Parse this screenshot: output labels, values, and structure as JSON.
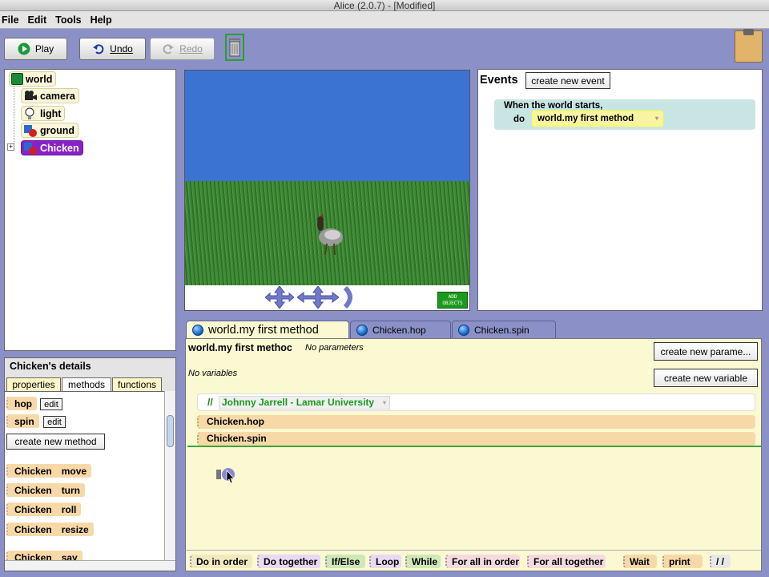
{
  "window": {
    "title": "Alice (2.0.7) -  [Modified]"
  },
  "menu": [
    "File",
    "Edit",
    "Tools",
    "Help"
  ],
  "toolbar": {
    "play": "Play",
    "undo": "Undo",
    "redo": "Redo"
  },
  "tree": {
    "world": "world",
    "camera": "camera",
    "light": "light",
    "ground": "ground",
    "chicken": "Chicken"
  },
  "view": {
    "add_objects": "ADD OBJECTS"
  },
  "events": {
    "title": "Events",
    "create_button": "create new event",
    "block_line1": "When the world starts,",
    "block_do": "do",
    "block_method": "world.my first method"
  },
  "details": {
    "title": "Chicken's details",
    "tabs": [
      "properties",
      "methods",
      "functions"
    ],
    "custom_methods": [
      {
        "name": "hop",
        "edit": "edit"
      },
      {
        "name": "spin",
        "edit": "edit"
      }
    ],
    "create_method": "create new method",
    "builtin_methods": [
      {
        "obj": "Chicken",
        "method": "move"
      },
      {
        "obj": "Chicken",
        "method": "turn"
      },
      {
        "obj": "Chicken",
        "method": "roll"
      },
      {
        "obj": "Chicken",
        "method": "resize"
      },
      {
        "obj": "Chicken",
        "method": "say"
      }
    ]
  },
  "editor": {
    "tabs": [
      "world.my first method",
      "Chicken.hop",
      "Chicken.spin"
    ],
    "title": "world.my first methoc",
    "no_params": "No parameters",
    "create_param": "create new parame...",
    "no_vars": "No variables",
    "create_var": "create new variable",
    "comment_slash": "//",
    "comment_text": "Johnny Jarrell - Lamar University",
    "statements": [
      "Chicken.hop",
      "Chicken.spin"
    ]
  },
  "controls": [
    "Do in order",
    "Do together",
    "If/Else",
    "Loop",
    "While",
    "For all in order",
    "For all together",
    "Wait",
    "print",
    "/ /"
  ],
  "colors": {
    "desktop": "#8b90c6",
    "sky": "#3b73d3",
    "grass": "#3f8a36",
    "selected": "#8a21c8",
    "method_block": "#f7d9a8",
    "editor_bg": "#fbf9d2",
    "event_block": "#c9e5e3"
  }
}
